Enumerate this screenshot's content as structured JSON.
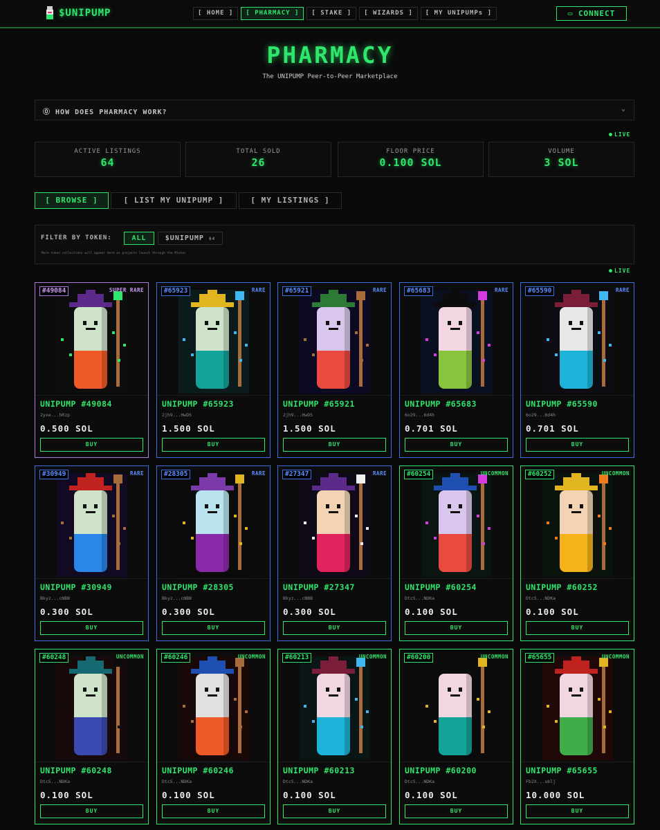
{
  "app": {
    "logo_text": "$UNIPUMP"
  },
  "nav": [
    "[ HOME ]",
    "[ PHARMACY ]",
    "[ STAKE ]",
    "[ WIZARDS ]",
    "[ MY UNIPUMPs ]"
  ],
  "connect_label": "CONNECT",
  "page": {
    "title": "PHARMACY",
    "subtitle": "The UNIPUMP Peer-to-Peer Marketplace"
  },
  "how": {
    "question": "HOW DOES PHARMACY WORK?"
  },
  "live_label": "LIVE",
  "stats": [
    {
      "label": "ACTIVE LISTINGS",
      "value": "64"
    },
    {
      "label": "TOTAL SOLD",
      "value": "26"
    },
    {
      "label": "FLOOR PRICE",
      "value": "0.100 SOL"
    },
    {
      "label": "VOLUME",
      "value": "3 SOL"
    }
  ],
  "tabs": [
    "[ BROWSE ]",
    "[ LIST MY UNIPUMP ]",
    "[ MY LISTINGS ]"
  ],
  "filter": {
    "label": "FILTER BY TOKEN:",
    "all_label": "ALL",
    "token_label": "$UNIPUMP",
    "token_sub": "64",
    "note": "More token collections will appear here as projects launch through the Minter"
  },
  "buy_label": "BUY",
  "listings": [
    {
      "id": "#49084",
      "rarity": "SUPER RARE",
      "tier": "super",
      "name": "UNIPUMP #49084",
      "seller": "2yxe...hRzp",
      "price": "0.500 SOL",
      "hat": "#5b2a8a",
      "upper": "#cfe3c9",
      "lower": "#f05a28",
      "staff_top": "#2ee66b",
      "bg": "#0d0d0d"
    },
    {
      "id": "#65923",
      "rarity": "RARE",
      "tier": "rare",
      "name": "UNIPUMP #65923",
      "seller": "2jh9...HwD5",
      "price": "1.500 SOL",
      "hat": "#e0b51f",
      "upper": "#cfe3c9",
      "lower": "#13a39a",
      "staff_top": "#3fb7f0",
      "bg": "#0b1a1a"
    },
    {
      "id": "#65921",
      "rarity": "RARE",
      "tier": "rare",
      "name": "UNIPUMP #65921",
      "seller": "2jh9...HwD5",
      "price": "1.500 SOL",
      "hat": "#2c7a35",
      "upper": "#d8c6ec",
      "lower": "#ea4a40",
      "staff_top": "#a86b3c",
      "bg": "#0c0a22"
    },
    {
      "id": "#65683",
      "rarity": "RARE",
      "tier": "rare",
      "name": "UNIPUMP #65683",
      "seller": "6o29...6d4h",
      "price": "0.701 SOL",
      "hat": "#0c0c0c",
      "upper": "#f2d7e2",
      "lower": "#89c43e",
      "staff_top": "#d53ce0",
      "bg": "#0a1020"
    },
    {
      "id": "#65590",
      "rarity": "RARE",
      "tier": "rare",
      "name": "UNIPUMP #65590",
      "seller": "6o29...6d4h",
      "price": "0.701 SOL",
      "hat": "#7a1e3a",
      "upper": "#e8e8e8",
      "lower": "#1eb3d8",
      "staff_top": "#3fb7f0",
      "bg": "#0c0c12"
    },
    {
      "id": "#30949",
      "rarity": "RARE",
      "tier": "rare",
      "name": "UNIPUMP #30949",
      "seller": "Bkyz...cNBB",
      "price": "0.300 SOL",
      "hat": "#c0231f",
      "upper": "#cfe3c9",
      "lower": "#2a86e8",
      "staff_top": "#a86b3c",
      "bg": "#120a22"
    },
    {
      "id": "#28305",
      "rarity": "RARE",
      "tier": "rare",
      "name": "UNIPUMP #28305",
      "seller": "Bkyz...cNBB",
      "price": "0.300 SOL",
      "hat": "#7a3aa8",
      "upper": "#b9e4ef",
      "lower": "#8b2aa8",
      "staff_top": "#e0b51f",
      "bg": "#0b0b0b"
    },
    {
      "id": "#27347",
      "rarity": "RARE",
      "tier": "rare",
      "name": "UNIPUMP #27347",
      "seller": "Bkyz...cNBB",
      "price": "0.300 SOL",
      "hat": "#5b2a8a",
      "upper": "#f2d4b5",
      "lower": "#e2245e",
      "staff_top": "#f0f0f0",
      "bg": "#100a18"
    },
    {
      "id": "#60254",
      "rarity": "UNCOMMON",
      "tier": "uncommon",
      "name": "UNIPUMP #60254",
      "seller": "DtcS...NDKa",
      "price": "0.100 SOL",
      "hat": "#1f4fb0",
      "upper": "#d8c6ec",
      "lower": "#ea4a40",
      "staff_top": "#d53ce0",
      "bg": "#0a1410"
    },
    {
      "id": "#60252",
      "rarity": "UNCOMMON",
      "tier": "uncommon",
      "name": "UNIPUMP #60252",
      "seller": "DtcS...NDKa",
      "price": "0.100 SOL",
      "hat": "#e0b51f",
      "upper": "#f2d4b5",
      "lower": "#f5b21a",
      "staff_top": "#f07a1e",
      "bg": "#0a120c"
    },
    {
      "id": "#60248",
      "rarity": "UNCOMMON",
      "tier": "uncommon",
      "name": "UNIPUMP #60248",
      "seller": "DtcS...NDKa",
      "price": "0.100 SOL",
      "hat": "#156a72",
      "upper": "#cfe3c9",
      "lower": "#3b4ab0",
      "staff_top": "#0c0c0c",
      "bg": "#180a0a"
    },
    {
      "id": "#60246",
      "rarity": "UNCOMMON",
      "tier": "uncommon",
      "name": "UNIPUMP #60246",
      "seller": "DtcS...NDKa",
      "price": "0.100 SOL",
      "hat": "#1f4fb0",
      "upper": "#e0e0e0",
      "lower": "#f05a28",
      "staff_top": "#a86b3c",
      "bg": "#180808"
    },
    {
      "id": "#60213",
      "rarity": "UNCOMMON",
      "tier": "uncommon",
      "name": "UNIPUMP #60213",
      "seller": "DtcS...NDKa",
      "price": "0.100 SOL",
      "hat": "#7a1e3a",
      "upper": "#f2d7e2",
      "lower": "#1eb3d8",
      "staff_top": "#3fb7f0",
      "bg": "#0a1616"
    },
    {
      "id": "#60200",
      "rarity": "UNCOMMON",
      "tier": "uncommon",
      "name": "UNIPUMP #60200",
      "seller": "DtcS...NDKa",
      "price": "0.100 SOL",
      "hat": "#0c0c0c",
      "upper": "#f2d7e2",
      "lower": "#13a39a",
      "staff_top": "#e0b51f",
      "bg": "#0b0b0b"
    },
    {
      "id": "#65655",
      "rarity": "UNCOMMON",
      "tier": "uncommon",
      "name": "UNIPUMP #65655",
      "seller": "Fb2X...ublj",
      "price": "10.000 SOL",
      "hat": "#c0231f",
      "upper": "#f2d7e2",
      "lower": "#3fae4a",
      "staff_top": "#e0b51f",
      "bg": "#200808"
    }
  ]
}
